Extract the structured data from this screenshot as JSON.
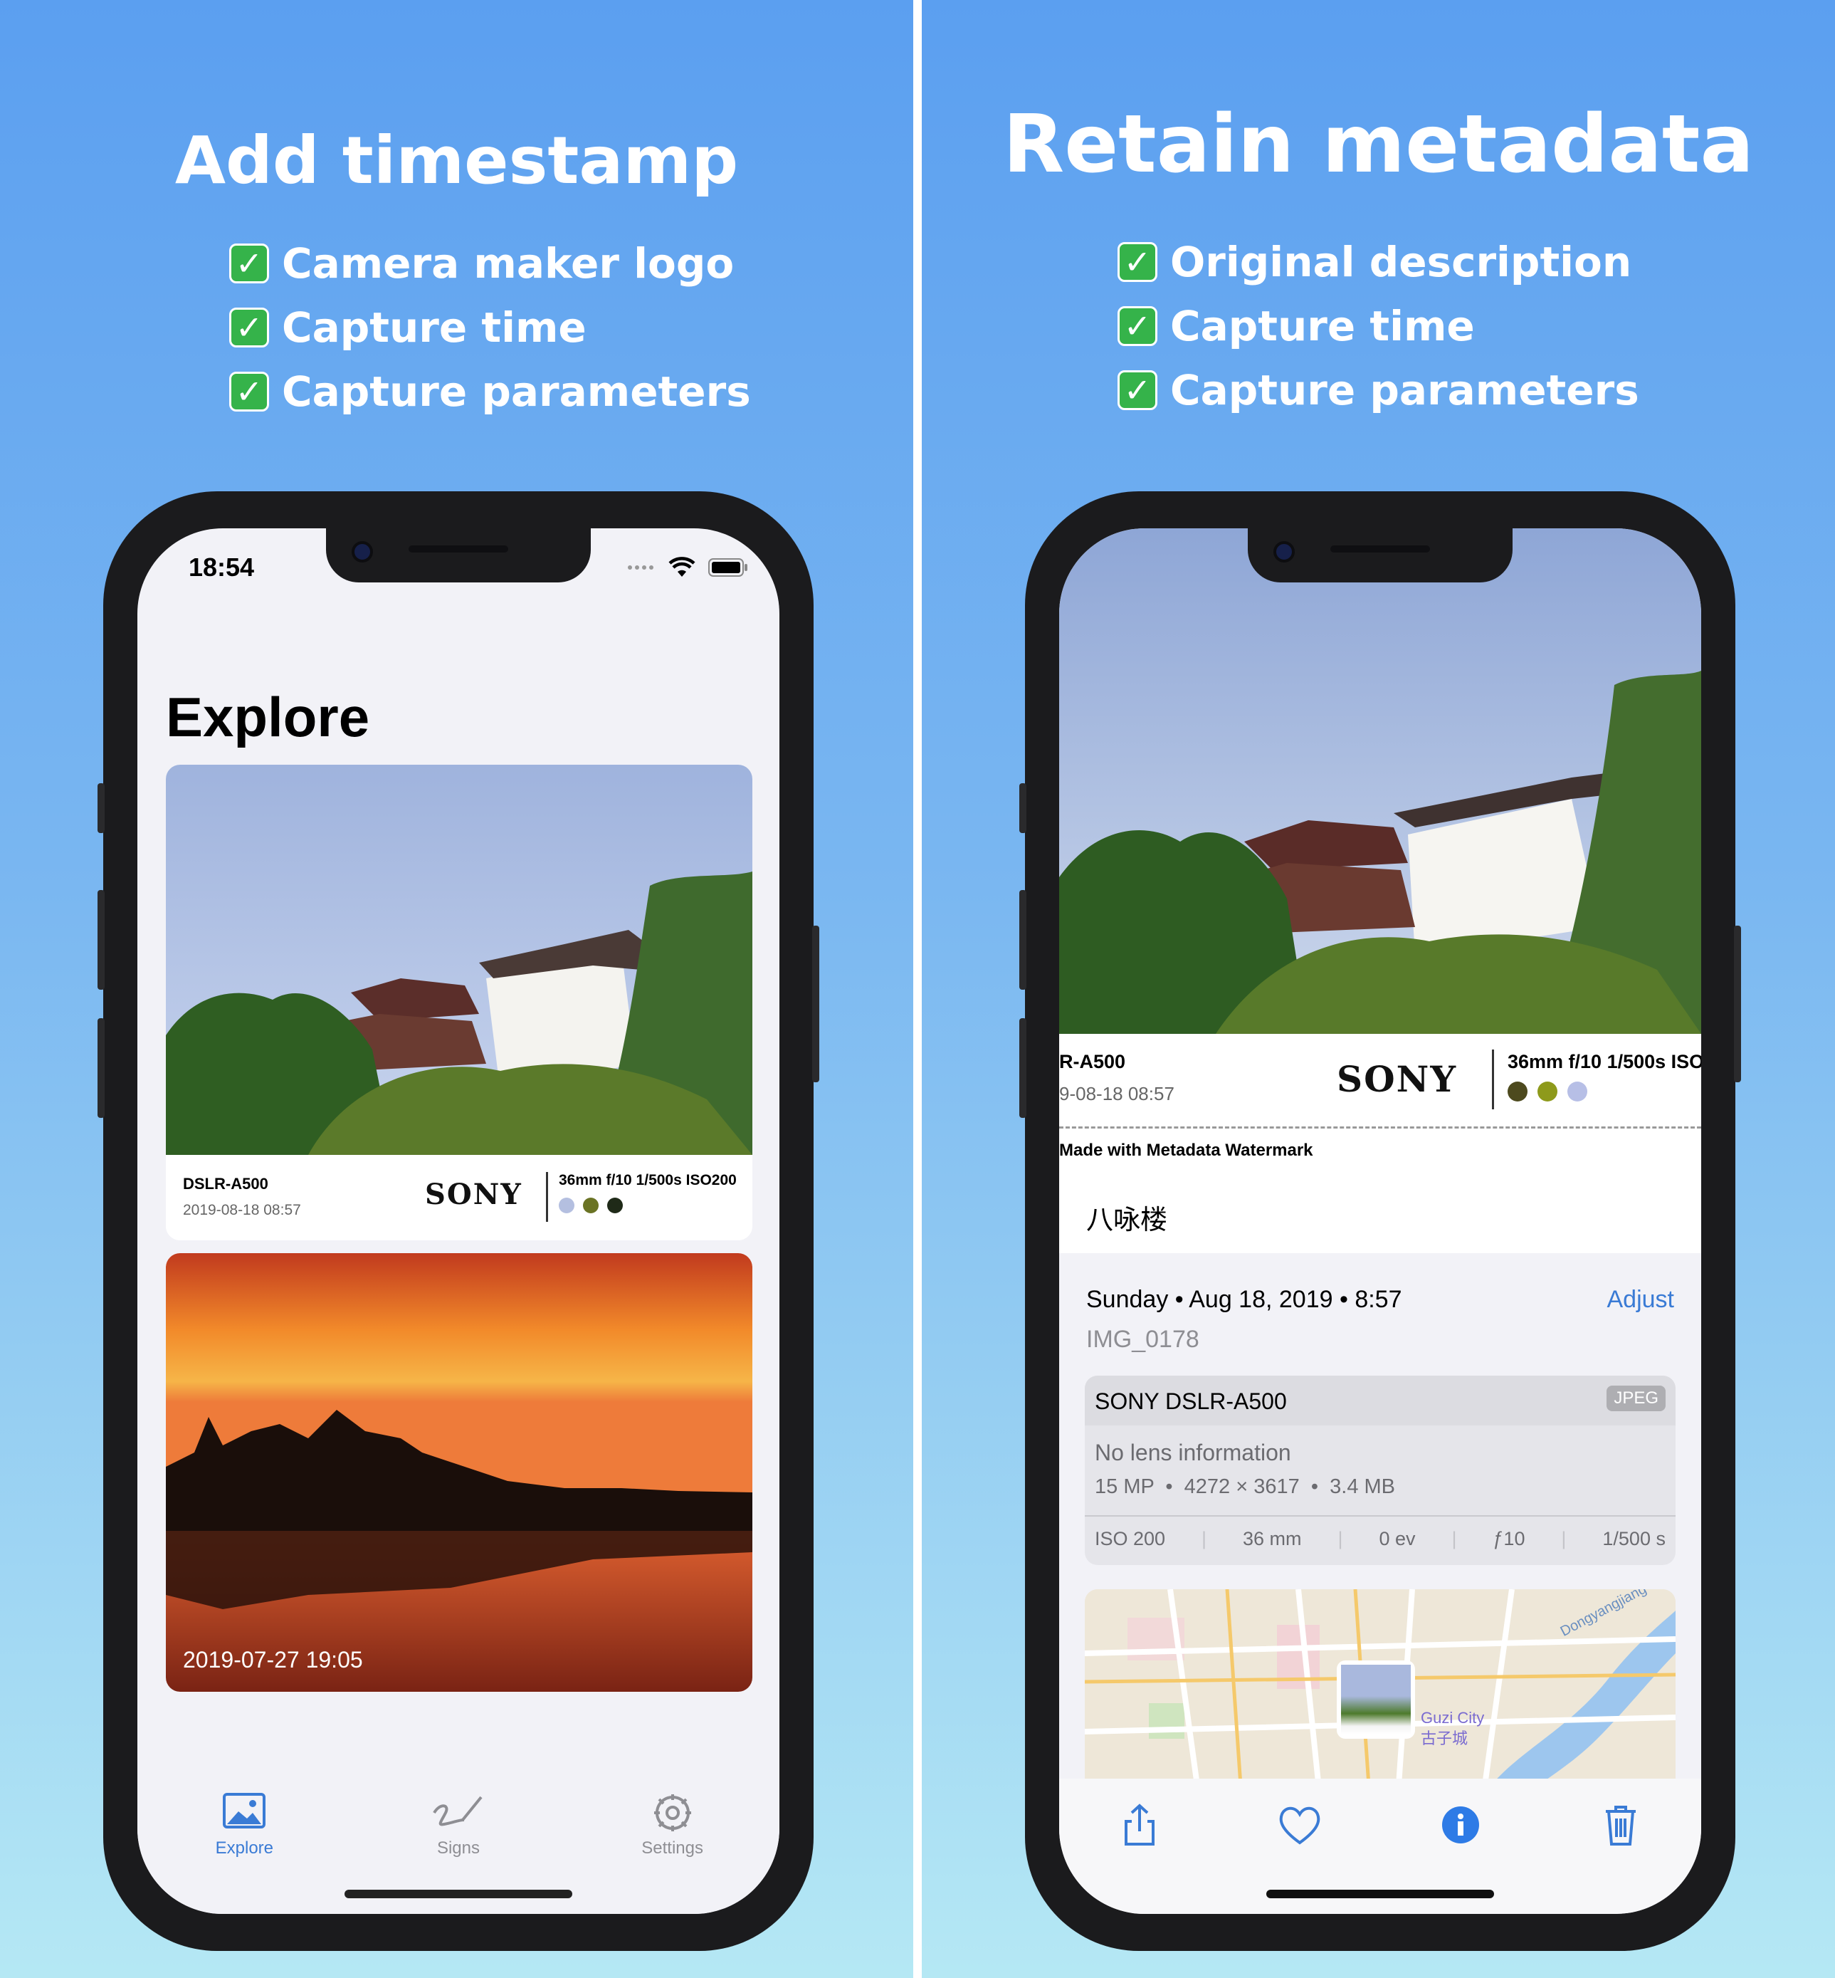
{
  "left": {
    "headline": "Add timestamp",
    "features": [
      "Camera maker logo",
      "Capture time",
      "Capture parameters"
    ],
    "check_glyph": "✓",
    "status": {
      "time": "18:54"
    },
    "explore_title": "Explore",
    "cards": [
      {
        "model": "DSLR-A500",
        "date": "2019-08-18 08:57",
        "brand": "SONY",
        "params": "36mm f/10 1/500s ISO200",
        "swatches": [
          "#b4bfe0",
          "#6a7324",
          "#1f2a18"
        ]
      },
      {
        "date_overlay": "2019-07-27 19:05"
      }
    ],
    "tabs": [
      {
        "label": "Explore",
        "icon": "photo-icon"
      },
      {
        "label": "Signs",
        "icon": "signature-icon"
      },
      {
        "label": "Settings",
        "icon": "gear-icon"
      }
    ]
  },
  "right": {
    "headline": "Retain metadata",
    "features": [
      "Original description",
      "Capture time",
      "Capture parameters"
    ],
    "check_glyph": "✓",
    "watermark": {
      "model": "R-A500",
      "date": "9-08-18 08:57",
      "brand": "SONY",
      "params": "36mm f/10 1/500s ISO",
      "swatches": [
        "#4d4a1e",
        "#8e9a1b",
        "#b7bfe6"
      ]
    },
    "made_with": "Made with Metadata Watermark",
    "caption": "八咏楼",
    "datetime": "Sunday • Aug 18, 2019 • 8:57",
    "adjust": "Adjust",
    "filename": "IMG_0178",
    "camera": "SONY DSLR-A500",
    "format_badge": "JPEG",
    "lens": "No lens information",
    "specs": "15 MP  •  4272 × 3617  •  3.4 MB",
    "exif": [
      "ISO 200",
      "36 mm",
      "0 ev",
      "ƒ10",
      "1/500 s"
    ],
    "map_labels": {
      "river": "Dongyangjiang",
      "city_en": "Guzi City",
      "city_zh": "古子城"
    },
    "toolbar": [
      "share-icon",
      "heart-icon",
      "info-icon",
      "trash-icon"
    ]
  }
}
